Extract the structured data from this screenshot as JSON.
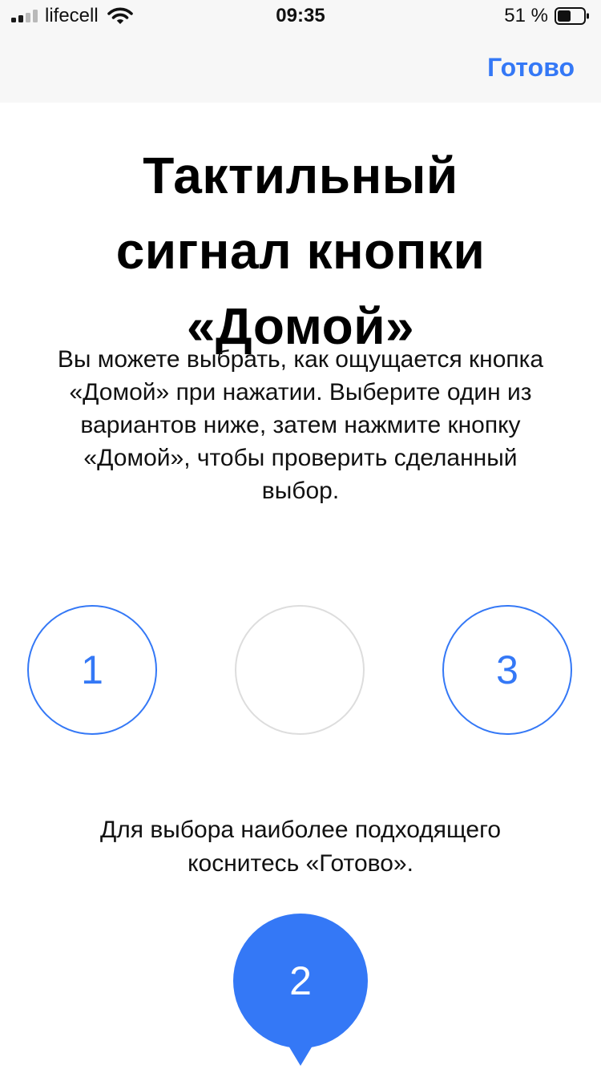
{
  "status_bar": {
    "carrier": "lifecell",
    "time": "09:35",
    "battery_percent": "51 %",
    "battery_level": 0.51,
    "signal_bars_active": 2,
    "signal_bars_total": 4
  },
  "nav": {
    "done_label": "Готово"
  },
  "content": {
    "title": "Тактильный сигнал кнопки «Домой»",
    "description": "Вы можете выбрать, как ощущается кнопка «Домой» при нажатии. Выберите один из вариантов ниже, затем нажмите кнопку «Домой», чтобы проверить сделанный выбор.",
    "options": [
      {
        "label": "1"
      },
      {
        "label": ""
      },
      {
        "label": "3"
      }
    ],
    "hint": "Для выбора наиболее подходящего коснитесь «Готово».",
    "selected_label": "2"
  },
  "colors": {
    "accent": "#3478f6",
    "unselected_border": "#dddddd",
    "bar_background": "#f7f7f7"
  },
  "icons": [
    "cellular-signal-icon",
    "wifi-icon",
    "battery-icon"
  ]
}
